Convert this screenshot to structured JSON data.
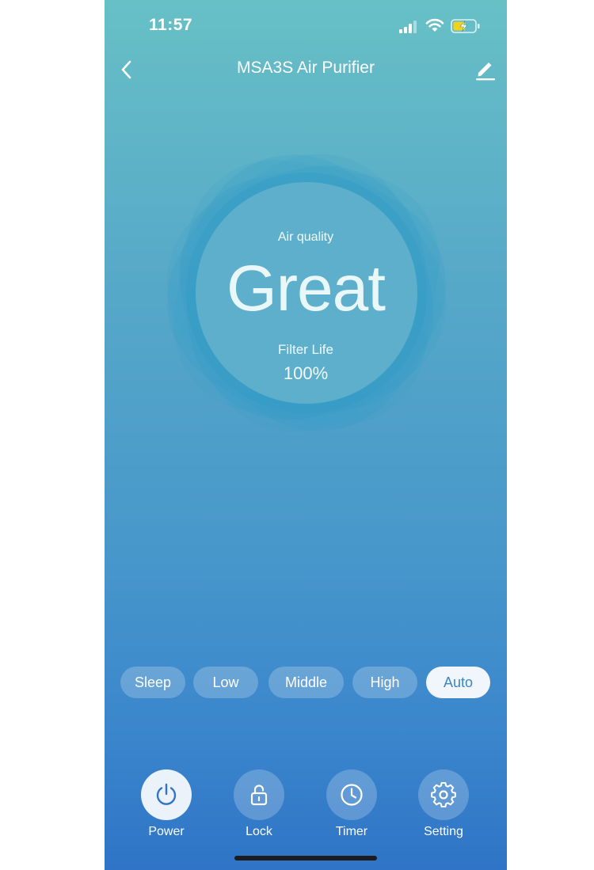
{
  "status_bar": {
    "time": "11:57"
  },
  "header": {
    "title": "MSA3S Air Purifier",
    "back_icon": "chevron-left-icon",
    "edit_icon": "pencil-icon"
  },
  "gauge": {
    "air_quality_label": "Air quality",
    "air_quality_value": "Great",
    "filter_label": "Filter Life",
    "filter_value": "100%"
  },
  "modes": {
    "items": [
      {
        "label": "Sleep",
        "active": false
      },
      {
        "label": "Low",
        "active": false
      },
      {
        "label": "Middle",
        "active": false
      },
      {
        "label": "High",
        "active": false
      },
      {
        "label": "Auto",
        "active": true
      }
    ]
  },
  "controls": {
    "items": [
      {
        "label": "Power",
        "icon": "power-icon",
        "on": true
      },
      {
        "label": "Lock",
        "icon": "unlock-icon",
        "on": false
      },
      {
        "label": "Timer",
        "icon": "clock-icon",
        "on": false
      },
      {
        "label": "Setting",
        "icon": "gear-icon",
        "on": false
      }
    ]
  },
  "colors": {
    "accent": "#3c85c8",
    "gradient_top": "#67c0c6",
    "gradient_bottom": "#2f74c6"
  }
}
